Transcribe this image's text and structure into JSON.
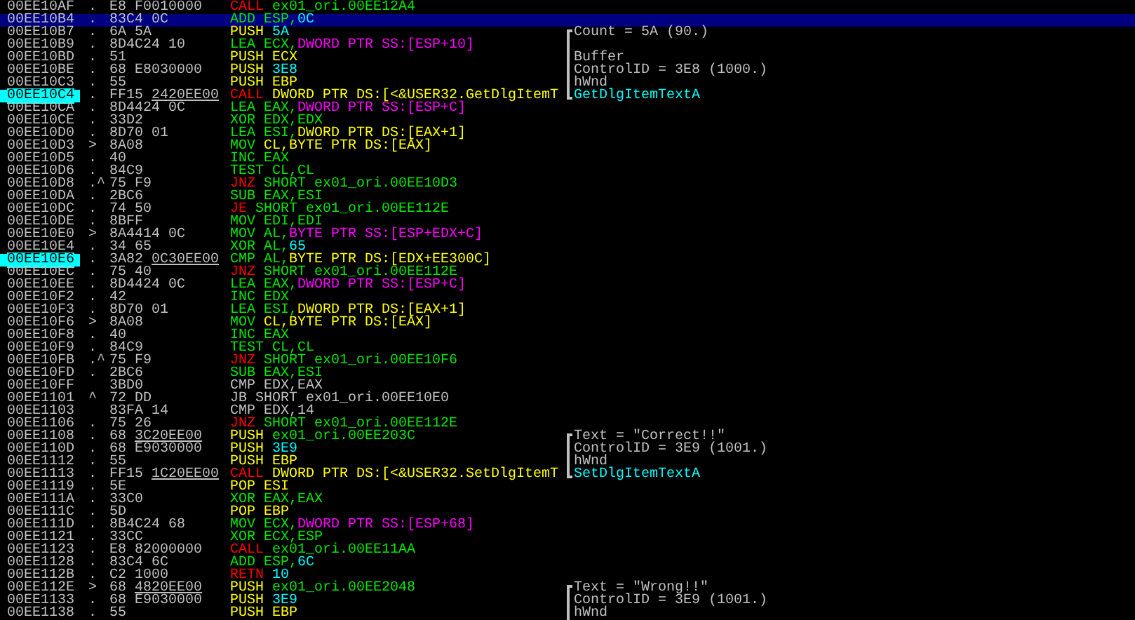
{
  "rows": [
    {
      "address": "00EE10AF",
      "marker": ".",
      "hex": "E8 F0010000",
      "asm": [
        {
          "kind": "jump",
          "text": "CALL "
        },
        {
          "kind": "label",
          "text": "ex01_ori.00EE12A4"
        }
      ],
      "selected": false,
      "marked": false
    },
    {
      "address": "00EE10B4",
      "marker": ".",
      "hex": "83C4 0C",
      "asm": [
        {
          "kind": "op",
          "text": "ADD ESP,"
        },
        {
          "kind": "const",
          "text": "0C"
        }
      ],
      "selected": true,
      "marked": false
    },
    {
      "address": "00EE10B7",
      "marker": ".",
      "hex": "6A 5A",
      "asm": [
        {
          "kind": "stack",
          "text": "PUSH "
        },
        {
          "kind": "const",
          "text": "5A"
        }
      ],
      "selected": false,
      "marked": false,
      "comment": {
        "text": "Count = 5A (90.)",
        "bracket_start": true,
        "bracket_end": false,
        "kind": "arg"
      }
    },
    {
      "address": "00EE10B9",
      "marker": ".",
      "hex": "8D4C24 10",
      "asm": [
        {
          "kind": "op",
          "text": "LEA ECX,"
        },
        {
          "kind": "ss",
          "text": "DWORD PTR SS:[ESP+10]"
        }
      ],
      "selected": false,
      "marked": false,
      "comment": {
        "bracket_start": false,
        "bracket_end": false
      }
    },
    {
      "address": "00EE10BD",
      "marker": ".",
      "hex": "51",
      "asm": [
        {
          "kind": "stack",
          "text": "PUSH ECX"
        }
      ],
      "selected": false,
      "marked": false,
      "comment": {
        "text": "Buffer",
        "bracket_start": false,
        "bracket_end": false,
        "kind": "arg"
      }
    },
    {
      "address": "00EE10BE",
      "marker": ".",
      "hex": "68 E8030000",
      "asm": [
        {
          "kind": "stack",
          "text": "PUSH "
        },
        {
          "kind": "const",
          "text": "3E8"
        }
      ],
      "selected": false,
      "marked": false,
      "comment": {
        "text": "ControlID = 3E8 (1000.)",
        "bracket_start": false,
        "bracket_end": false,
        "kind": "arg"
      }
    },
    {
      "address": "00EE10C3",
      "marker": ".",
      "hex": "55",
      "asm": [
        {
          "kind": "stack",
          "text": "PUSH EBP"
        }
      ],
      "selected": false,
      "marked": false,
      "comment": {
        "text": "hWnd",
        "bracket_start": false,
        "bracket_end": false,
        "kind": "arg"
      }
    },
    {
      "address": "00EE10C4",
      "marker": ".",
      "hex": "FF15",
      "fixup": "2420EE00",
      "asm": [
        {
          "kind": "jump",
          "text": "CALL "
        },
        {
          "kind": "ds",
          "text": "DWORD PTR DS:[<&USER32.GetDlgItemT"
        }
      ],
      "selected": false,
      "marked": true,
      "comment": {
        "text": "GetDlgItemTextA",
        "bracket_start": false,
        "bracket_end": true,
        "kind": "func"
      }
    },
    {
      "address": "00EE10CA",
      "marker": ".",
      "hex": "8D4424 0C",
      "asm": [
        {
          "kind": "op",
          "text": "LEA EAX,"
        },
        {
          "kind": "ss",
          "text": "DWORD PTR SS:[ESP+C]"
        }
      ],
      "selected": false,
      "marked": false
    },
    {
      "address": "00EE10CE",
      "marker": ".",
      "hex": "33D2",
      "asm": [
        {
          "kind": "op",
          "text": "XOR EDX,EDX"
        }
      ],
      "selected": false,
      "marked": false
    },
    {
      "address": "00EE10D0",
      "marker": ".",
      "hex": "8D70 01",
      "asm": [
        {
          "kind": "op",
          "text": "LEA ESI,"
        },
        {
          "kind": "ds",
          "text": "DWORD PTR DS:[EAX+1]"
        }
      ],
      "selected": false,
      "marked": false
    },
    {
      "address": "00EE10D3",
      "marker": ">",
      "hex": "8A08",
      "asm": [
        {
          "kind": "op",
          "text": "MOV "
        },
        {
          "kind": "ds",
          "text": "CL,BYTE PTR DS:[EAX]"
        }
      ],
      "selected": false,
      "marked": false
    },
    {
      "address": "00EE10D5",
      "marker": ".",
      "hex": "40",
      "asm": [
        {
          "kind": "op",
          "text": "INC EAX"
        }
      ],
      "selected": false,
      "marked": false
    },
    {
      "address": "00EE10D6",
      "marker": ".",
      "hex": "84C9",
      "asm": [
        {
          "kind": "op",
          "text": "TEST CL,CL"
        }
      ],
      "selected": false,
      "marked": false
    },
    {
      "address": "00EE10D8",
      "marker": ".^",
      "hex": "75 F9",
      "asm": [
        {
          "kind": "jump",
          "text": "JNZ "
        },
        {
          "kind": "label",
          "text": "SHORT ex01_ori.00EE10D3"
        }
      ],
      "selected": false,
      "marked": false
    },
    {
      "address": "00EE10DA",
      "marker": ".",
      "hex": "2BC6",
      "asm": [
        {
          "kind": "op",
          "text": "SUB EAX,ESI"
        }
      ],
      "selected": false,
      "marked": false
    },
    {
      "address": "00EE10DC",
      "marker": ".",
      "hex": "74 50",
      "asm": [
        {
          "kind": "jump",
          "text": "JE "
        },
        {
          "kind": "label",
          "text": "SHORT ex01_ori.00EE112E"
        }
      ],
      "selected": false,
      "marked": false
    },
    {
      "address": "00EE10DE",
      "marker": ".",
      "hex": "8BFF",
      "asm": [
        {
          "kind": "op",
          "text": "MOV EDI,EDI"
        }
      ],
      "selected": false,
      "marked": false
    },
    {
      "address": "00EE10E0",
      "marker": ">",
      "hex": "8A4414 0C",
      "asm": [
        {
          "kind": "op",
          "text": "MOV AL,"
        },
        {
          "kind": "ss",
          "text": "BYTE PTR SS:[ESP+EDX+C]"
        }
      ],
      "selected": false,
      "marked": false
    },
    {
      "address": "00EE10E4",
      "marker": ".",
      "hex": "34 65",
      "asm": [
        {
          "kind": "op",
          "text": "XOR AL,"
        },
        {
          "kind": "const",
          "text": "65"
        }
      ],
      "selected": false,
      "marked": false
    },
    {
      "address": "00EE10E6",
      "marker": ".",
      "hex": "3A82",
      "fixup": "0C30EE00",
      "asm": [
        {
          "kind": "op",
          "text": "CMP AL,"
        },
        {
          "kind": "ds",
          "text": "BYTE PTR DS:[EDX+EE300C]"
        }
      ],
      "selected": false,
      "marked": true
    },
    {
      "address": "00EE10EC",
      "marker": ".",
      "hex": "75 40",
      "asm": [
        {
          "kind": "jump",
          "text": "JNZ "
        },
        {
          "kind": "label",
          "text": "SHORT ex01_ori.00EE112E"
        }
      ],
      "selected": false,
      "marked": false
    },
    {
      "address": "00EE10EE",
      "marker": ".",
      "hex": "8D4424 0C",
      "asm": [
        {
          "kind": "op",
          "text": "LEA EAX,"
        },
        {
          "kind": "ss",
          "text": "DWORD PTR SS:[ESP+C]"
        }
      ],
      "selected": false,
      "marked": false
    },
    {
      "address": "00EE10F2",
      "marker": ".",
      "hex": "42",
      "asm": [
        {
          "kind": "op",
          "text": "INC EDX"
        }
      ],
      "selected": false,
      "marked": false
    },
    {
      "address": "00EE10F3",
      "marker": ".",
      "hex": "8D70 01",
      "asm": [
        {
          "kind": "op",
          "text": "LEA ESI,"
        },
        {
          "kind": "ds",
          "text": "DWORD PTR DS:[EAX+1]"
        }
      ],
      "selected": false,
      "marked": false
    },
    {
      "address": "00EE10F6",
      "marker": ">",
      "hex": "8A08",
      "asm": [
        {
          "kind": "op",
          "text": "MOV "
        },
        {
          "kind": "ds",
          "text": "CL,BYTE PTR DS:[EAX]"
        }
      ],
      "selected": false,
      "marked": false
    },
    {
      "address": "00EE10F8",
      "marker": ".",
      "hex": "40",
      "asm": [
        {
          "kind": "op",
          "text": "INC EAX"
        }
      ],
      "selected": false,
      "marked": false
    },
    {
      "address": "00EE10F9",
      "marker": ".",
      "hex": "84C9",
      "asm": [
        {
          "kind": "op",
          "text": "TEST CL,CL"
        }
      ],
      "selected": false,
      "marked": false
    },
    {
      "address": "00EE10FB",
      "marker": ".^",
      "hex": "75 F9",
      "asm": [
        {
          "kind": "jump",
          "text": "JNZ "
        },
        {
          "kind": "label",
          "text": "SHORT ex01_ori.00EE10F6"
        }
      ],
      "selected": false,
      "marked": false
    },
    {
      "address": "00EE10FD",
      "marker": ".",
      "hex": "2BC6",
      "asm": [
        {
          "kind": "op",
          "text": "SUB EAX,ESI"
        }
      ],
      "selected": false,
      "marked": false
    },
    {
      "address": "00EE10FF",
      "hex": "3BD0",
      "asm": [
        {
          "kind": "plain",
          "text": "CMP EDX,EAX"
        }
      ],
      "selected": false,
      "marked": false
    },
    {
      "address": "00EE1101",
      "marker": "^",
      "hex": "72 DD",
      "asm": [
        {
          "kind": "plain",
          "text": "JB SHORT ex01_ori.00EE10E0"
        }
      ],
      "selected": false,
      "marked": false
    },
    {
      "address": "00EE1103",
      "hex": "83FA 14",
      "asm": [
        {
          "kind": "plain",
          "text": "CMP EDX,14"
        }
      ],
      "selected": false,
      "marked": false
    },
    {
      "address": "00EE1106",
      "marker": ".",
      "hex": "75 26",
      "asm": [
        {
          "kind": "jump",
          "text": "JNZ "
        },
        {
          "kind": "label",
          "text": "SHORT ex01_ori.00EE112E"
        }
      ],
      "selected": false,
      "marked": false
    },
    {
      "address": "00EE1108",
      "marker": ".",
      "hex": "68",
      "fixup": "3C20EE00",
      "asm": [
        {
          "kind": "stack",
          "text": "PUSH "
        },
        {
          "kind": "label",
          "text": "ex01_ori.00EE203C"
        }
      ],
      "selected": false,
      "marked": false,
      "comment": {
        "text": "Text = \"Correct!!\"",
        "bracket_start": true,
        "bracket_end": false,
        "kind": "arg"
      }
    },
    {
      "address": "00EE110D",
      "marker": ".",
      "hex": "68 E9030000",
      "asm": [
        {
          "kind": "stack",
          "text": "PUSH "
        },
        {
          "kind": "const",
          "text": "3E9"
        }
      ],
      "selected": false,
      "marked": false,
      "comment": {
        "text": "ControlID = 3E9 (1001.)",
        "bracket_start": false,
        "bracket_end": false,
        "kind": "arg"
      }
    },
    {
      "address": "00EE1112",
      "marker": ".",
      "hex": "55",
      "asm": [
        {
          "kind": "stack",
          "text": "PUSH EBP"
        }
      ],
      "selected": false,
      "marked": false,
      "comment": {
        "text": "hWnd",
        "bracket_start": false,
        "bracket_end": false,
        "kind": "arg"
      }
    },
    {
      "address": "00EE1113",
      "marker": ".",
      "hex": "FF15",
      "fixup": "1C20EE00",
      "asm": [
        {
          "kind": "jump",
          "text": "CALL "
        },
        {
          "kind": "ds",
          "text": "DWORD PTR DS:[<&USER32.SetDlgItemT"
        }
      ],
      "selected": false,
      "marked": false,
      "comment": {
        "text": "SetDlgItemTextA",
        "bracket_start": false,
        "bracket_end": true,
        "kind": "func"
      }
    },
    {
      "address": "00EE1119",
      "marker": ".",
      "hex": "5E",
      "asm": [
        {
          "kind": "stack",
          "text": "POP ESI"
        }
      ],
      "selected": false,
      "marked": false
    },
    {
      "address": "00EE111A",
      "marker": ".",
      "hex": "33C0",
      "asm": [
        {
          "kind": "op",
          "text": "XOR EAX,EAX"
        }
      ],
      "selected": false,
      "marked": false
    },
    {
      "address": "00EE111C",
      "marker": ".",
      "hex": "5D",
      "asm": [
        {
          "kind": "stack",
          "text": "POP EBP"
        }
      ],
      "selected": false,
      "marked": false
    },
    {
      "address": "00EE111D",
      "marker": ".",
      "hex": "8B4C24 68",
      "asm": [
        {
          "kind": "op",
          "text": "MOV ECX,"
        },
        {
          "kind": "ss",
          "text": "DWORD PTR SS:[ESP+68]"
        }
      ],
      "selected": false,
      "marked": false
    },
    {
      "address": "00EE1121",
      "marker": ".",
      "hex": "33CC",
      "asm": [
        {
          "kind": "op",
          "text": "XOR ECX,ESP"
        }
      ],
      "selected": false,
      "marked": false
    },
    {
      "address": "00EE1123",
      "marker": ".",
      "hex": "E8 82000000",
      "asm": [
        {
          "kind": "jump",
          "text": "CALL "
        },
        {
          "kind": "label",
          "text": "ex01_ori.00EE11AA"
        }
      ],
      "selected": false,
      "marked": false
    },
    {
      "address": "00EE1128",
      "marker": ".",
      "hex": "83C4 6C",
      "asm": [
        {
          "kind": "op",
          "text": "ADD ESP,"
        },
        {
          "kind": "const",
          "text": "6C"
        }
      ],
      "selected": false,
      "marked": false
    },
    {
      "address": "00EE112B",
      "marker": ".",
      "hex": "C2 1000",
      "asm": [
        {
          "kind": "jump",
          "text": "RETN "
        },
        {
          "kind": "const",
          "text": "10"
        }
      ],
      "selected": false,
      "marked": false
    },
    {
      "address": "00EE112E",
      "marker": ">",
      "hex": "68",
      "fixup": "4820EE00",
      "asm": [
        {
          "kind": "stack",
          "text": "PUSH "
        },
        {
          "kind": "label",
          "text": "ex01_ori.00EE2048"
        }
      ],
      "selected": false,
      "marked": false,
      "comment": {
        "text": "Text = \"Wrong!!\"",
        "bracket_start": true,
        "bracket_end": false,
        "kind": "arg"
      }
    },
    {
      "address": "00EE1133",
      "marker": ".",
      "hex": "68 E9030000",
      "asm": [
        {
          "kind": "stack",
          "text": "PUSH "
        },
        {
          "kind": "const",
          "text": "3E9"
        }
      ],
      "selected": false,
      "marked": false,
      "comment": {
        "text": "ControlID = 3E9 (1001.)",
        "bracket_start": false,
        "bracket_end": false,
        "kind": "arg"
      }
    },
    {
      "address": "00EE1138",
      "marker": ".",
      "hex": "55",
      "asm": [
        {
          "kind": "stack",
          "text": "PUSH EBP"
        }
      ],
      "selected": false,
      "marked": false,
      "comment": {
        "text": "hWnd",
        "bracket_start": false,
        "bracket_end": false,
        "kind": "arg"
      }
    }
  ]
}
